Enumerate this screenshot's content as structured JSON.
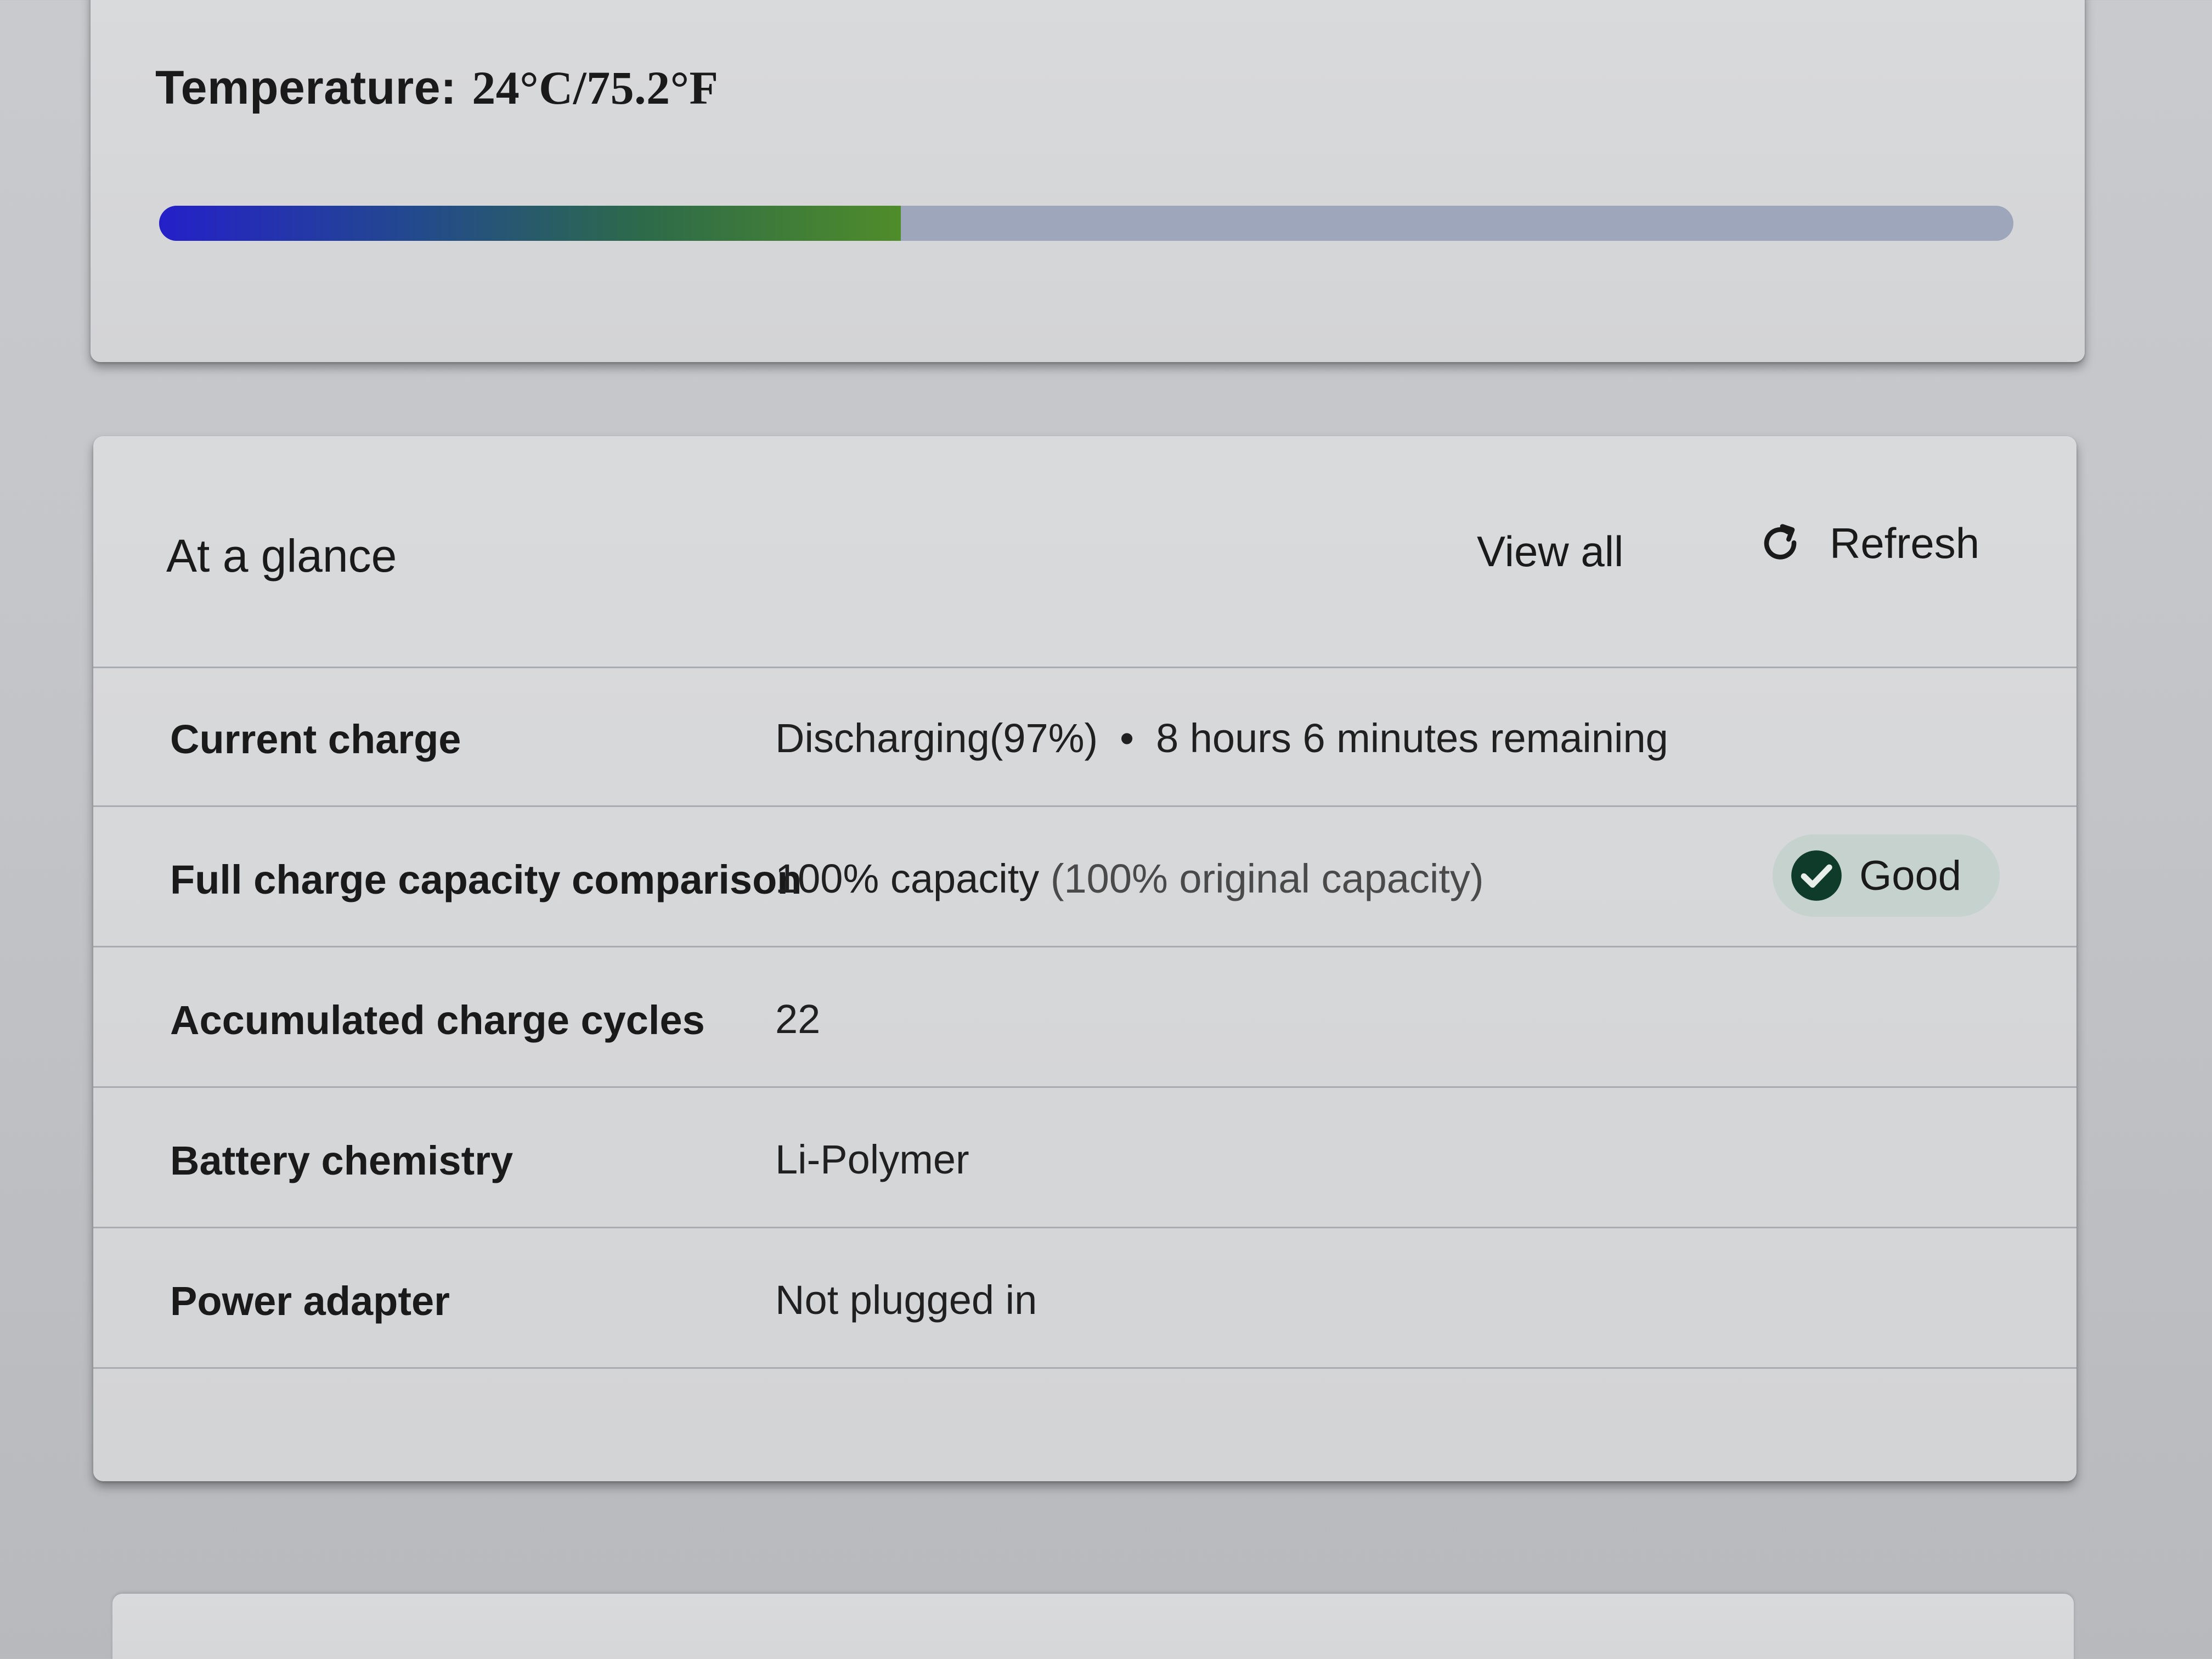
{
  "temperature": {
    "label": "Temperature:",
    "value": "24°C/75.2°F",
    "level_percent": 40,
    "track_color": "#9ea6bb"
  },
  "glance": {
    "title": "At a glance",
    "view_all_label": "View all",
    "refresh_label": "Refresh",
    "refresh_icon": "refresh-icon",
    "rows": [
      {
        "label": "Current charge",
        "value": "Discharging(97%)",
        "separator": "•",
        "extra": "8 hours 6 minutes remaining"
      },
      {
        "label": "Full charge capacity comparison",
        "value": "100% capacity",
        "sub": "(100% original capacity)",
        "badge": {
          "label": "Good",
          "icon": "check-circle-icon",
          "color": "#0f3b2a"
        }
      },
      {
        "label": "Accumulated charge cycles",
        "value": "22"
      },
      {
        "label": "Battery chemistry",
        "value": "Li-Polymer"
      },
      {
        "label": "Power adapter",
        "value": "Not plugged in"
      }
    ]
  }
}
